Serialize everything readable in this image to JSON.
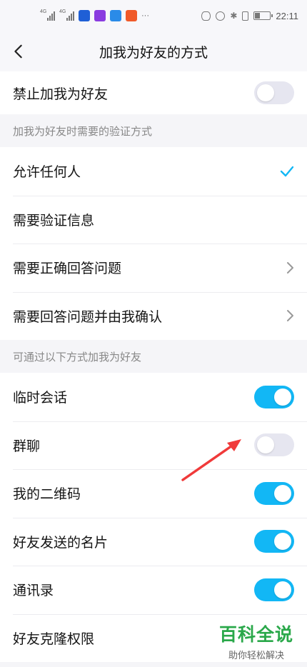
{
  "status_bar": {
    "signal_1": "4G",
    "signal_2": "4G",
    "more": "···",
    "time": "22:11"
  },
  "header": {
    "title": "加我为好友的方式",
    "back_icon": "chevron-left-icon"
  },
  "ban_row": {
    "label": "禁止加我为好友",
    "enabled": false
  },
  "verify_section": {
    "header": "加我为好友时需要的验证方式",
    "options": [
      {
        "label": "允许任何人",
        "selected": true
      },
      {
        "label": "需要验证信息"
      },
      {
        "label": "需要正确回答问题",
        "has_chevron": true
      },
      {
        "label": "需要回答问题并由我确认",
        "has_chevron": true
      }
    ]
  },
  "methods_section": {
    "header": "可通过以下方式加我为好友",
    "items": [
      {
        "label": "临时会话",
        "enabled": true
      },
      {
        "label": "群聊",
        "enabled": false
      },
      {
        "label": "我的二维码",
        "enabled": true
      },
      {
        "label": "好友发送的名片",
        "enabled": true
      },
      {
        "label": "通讯录",
        "enabled": true
      },
      {
        "label": "好友克隆权限"
      }
    ]
  },
  "watermark": {
    "title": "百科全说",
    "subtitle": "助你轻松解决"
  },
  "colors": {
    "accent": "#12b7f5",
    "toggle_off": "#e6e6f0",
    "arrow": "#f03a3a",
    "watermark": "#2aa84a"
  }
}
